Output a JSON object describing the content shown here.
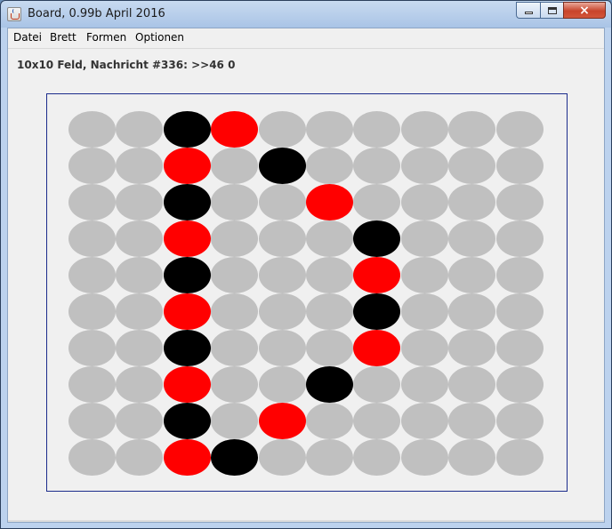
{
  "window": {
    "title": "Board, 0.99b April 2016",
    "controls": {
      "minimize": "minimize",
      "maximize": "maximize",
      "close": "×"
    }
  },
  "menu": {
    "items": [
      "Datei",
      "Brett",
      "Formen",
      "Optionen"
    ]
  },
  "status": {
    "text": "10x10 Feld, Nachricht #336: >>46 0"
  },
  "board": {
    "rows": 10,
    "cols": 10,
    "colors": {
      "empty": "#c0c0c0",
      "black": "#000000",
      "red": "#ff0000"
    },
    "cells": [
      [
        "empty",
        "empty",
        "black",
        "red",
        "empty",
        "empty",
        "empty",
        "empty",
        "empty",
        "empty"
      ],
      [
        "empty",
        "empty",
        "red",
        "empty",
        "black",
        "empty",
        "empty",
        "empty",
        "empty",
        "empty"
      ],
      [
        "empty",
        "empty",
        "black",
        "empty",
        "empty",
        "red",
        "empty",
        "empty",
        "empty",
        "empty"
      ],
      [
        "empty",
        "empty",
        "red",
        "empty",
        "empty",
        "empty",
        "black",
        "empty",
        "empty",
        "empty"
      ],
      [
        "empty",
        "empty",
        "black",
        "empty",
        "empty",
        "empty",
        "red",
        "empty",
        "empty",
        "empty"
      ],
      [
        "empty",
        "empty",
        "red",
        "empty",
        "empty",
        "empty",
        "black",
        "empty",
        "empty",
        "empty"
      ],
      [
        "empty",
        "empty",
        "black",
        "empty",
        "empty",
        "empty",
        "red",
        "empty",
        "empty",
        "empty"
      ],
      [
        "empty",
        "empty",
        "red",
        "empty",
        "empty",
        "black",
        "empty",
        "empty",
        "empty",
        "empty"
      ],
      [
        "empty",
        "empty",
        "black",
        "empty",
        "red",
        "empty",
        "empty",
        "empty",
        "empty",
        "empty"
      ],
      [
        "empty",
        "empty",
        "red",
        "black",
        "empty",
        "empty",
        "empty",
        "empty",
        "empty",
        "empty"
      ]
    ]
  }
}
